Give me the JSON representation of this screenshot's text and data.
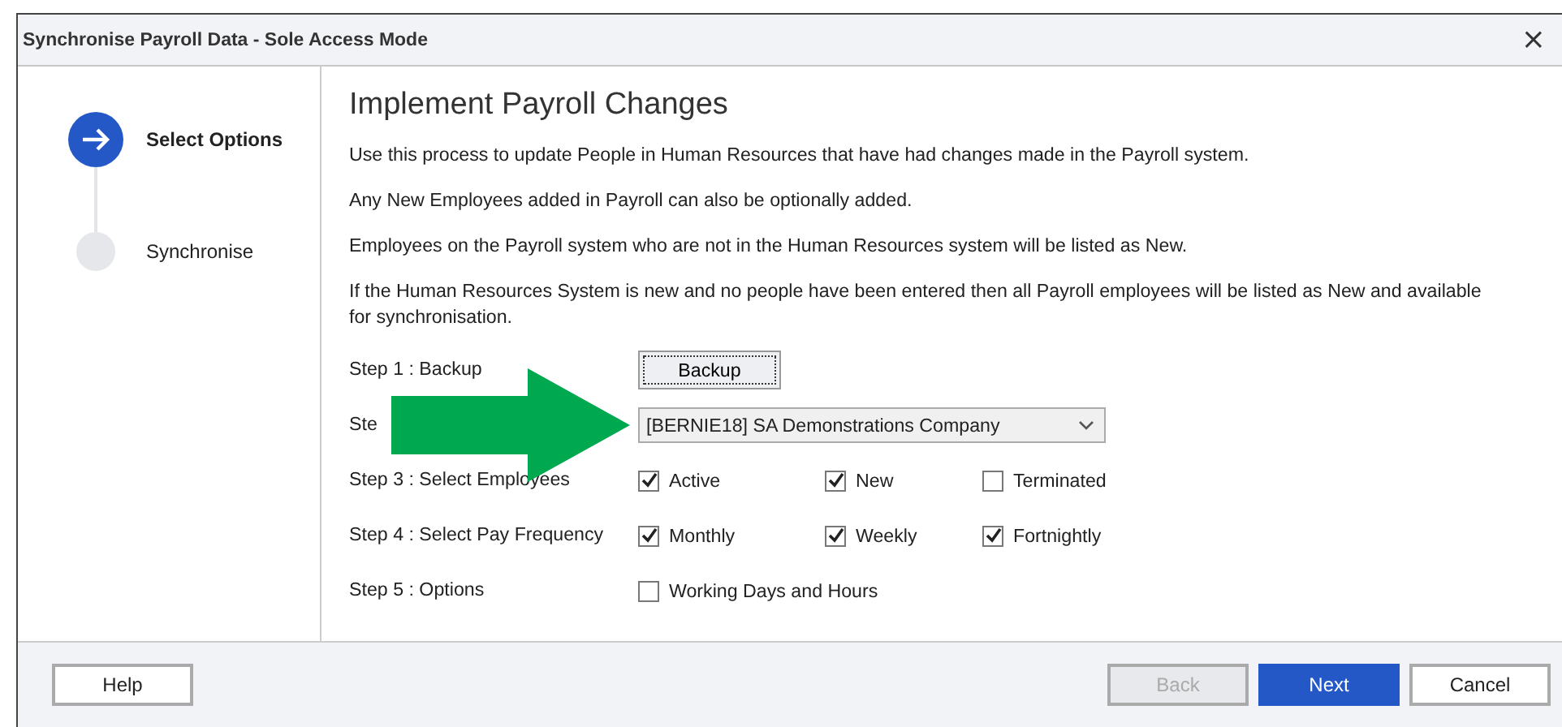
{
  "window": {
    "title": "Synchronise Payroll Data - Sole Access Mode",
    "close": "×"
  },
  "steps": [
    {
      "label": "Select Options",
      "selected": true
    },
    {
      "label": "Synchronise",
      "selected": false
    }
  ],
  "heading": "Implement Payroll Changes",
  "paragraphs": [
    "Use this process to update People in Human Resources that have had changes made in the Payroll system.",
    "Any New Employees added in Payroll can also be optionally added.",
    "Employees on the Payroll system who are not in the Human Resources system will be listed as New.",
    "If the Human Resources System is new and no people have been entered then all Payroll employees will be listed as New and available for synchronisation."
  ],
  "form_rows": [
    {
      "label": "Step 1 : Backup",
      "kind": "button",
      "button": "Backup"
    },
    {
      "label": "Ste",
      "kind": "dropdown",
      "value": "[BERNIE18]  SA Demonstrations Company"
    },
    {
      "label": "Step 3 : Select Employees",
      "kind": "checkboxes",
      "options": [
        {
          "label": "Active",
          "checked": true
        },
        {
          "label": "New",
          "checked": true
        },
        {
          "label": "Terminated",
          "checked": false
        }
      ]
    },
    {
      "label": "Step 4 : Select Pay Frequency",
      "kind": "checkboxes",
      "options": [
        {
          "label": "Monthly",
          "checked": true
        },
        {
          "label": "Weekly",
          "checked": true
        },
        {
          "label": "Fortnightly",
          "checked": true
        }
      ]
    },
    {
      "label": "Step 5 : Options",
      "kind": "checkboxes",
      "options": [
        {
          "label": "Working Days and Hours",
          "checked": false
        }
      ]
    }
  ],
  "footer": {
    "left_buttons": [
      {
        "label": "Help",
        "kind": "normal",
        "disabled": false
      }
    ],
    "right_buttons": [
      {
        "label": "Back",
        "kind": "normal",
        "disabled": true
      },
      {
        "label": "Next",
        "kind": "primary",
        "disabled": false
      },
      {
        "label": "Cancel",
        "kind": "normal",
        "disabled": false
      }
    ]
  }
}
